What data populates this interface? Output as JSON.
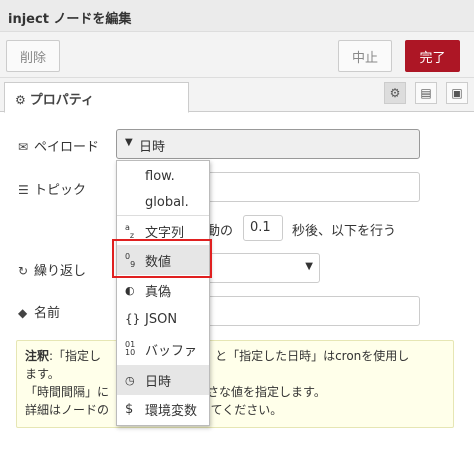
{
  "title": "inject ノードを編集",
  "buttons": {
    "delete": "削除",
    "cancel": "中止",
    "done": "完了"
  },
  "tab": {
    "label": "プロパティ",
    "icon": "gear-icon"
  },
  "tab_icons": [
    "gear-icon",
    "document-icon",
    "frame-icon"
  ],
  "fields": {
    "payload_label": "ペイロード",
    "payload_value": "日時",
    "topic_label": "トピック",
    "repeat_label": "繰り返し",
    "name_label": "名前",
    "inject_text_suffix": "動の",
    "inject_seconds": "0.1",
    "inject_text_after": "秒後、以下を行う"
  },
  "dropdown": {
    "items": [
      {
        "icon": "",
        "label": "flow."
      },
      {
        "icon": "",
        "label": "global."
      },
      {
        "icon": "az",
        "label": "文字列"
      },
      {
        "icon": "09",
        "label": "数値"
      },
      {
        "icon": "◐",
        "label": "真偽"
      },
      {
        "icon": "{}",
        "label": "JSON"
      },
      {
        "icon": "0110",
        "label": "バッファ"
      },
      {
        "icon": "◷",
        "label": "日時"
      },
      {
        "icon": "$",
        "label": "環境変数"
      }
    ],
    "highlighted": "数値",
    "selected": "日時"
  },
  "note": {
    "label": "注釈",
    "line1_a": ":「指定し",
    "line1_b": "時」と「指定した日時」はcronを使用し",
    "line2": "ます。",
    "line3_a": "「時間間隔」に",
    "line3_b": "小さな値を指定します。",
    "line4_a": "詳細はノードの",
    "line4_b": "してください。"
  },
  "colors": {
    "done_button": "#ad1625",
    "highlight_box": "#e02020",
    "note_bg": "#ffffea"
  }
}
